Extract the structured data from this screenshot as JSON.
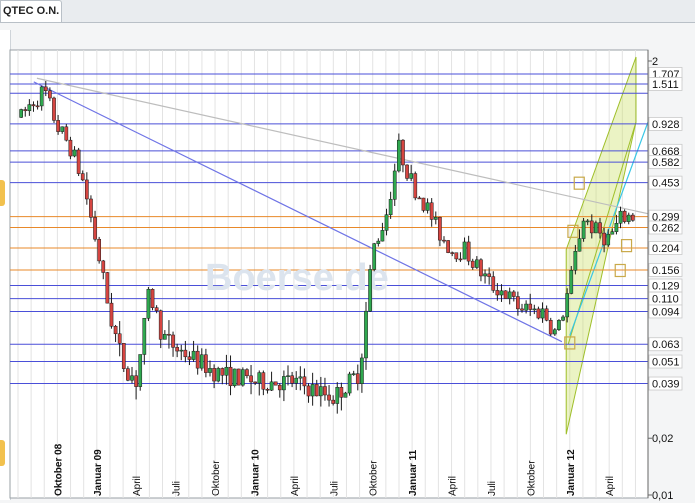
{
  "tab": {
    "title": "QTEC O.N."
  },
  "watermark": "Boerse.de",
  "chart_data": {
    "type": "candlestick",
    "title": "QTEC O.N.",
    "y_scale": "log",
    "ylim": [
      0.01,
      2
    ],
    "y_ticks_gray": [
      "2",
      "0,02",
      "0,01"
    ],
    "y_ticks_boxed": [
      "1.707",
      "1.511",
      "0.928",
      "0.668",
      "0.582",
      "0.453",
      "0.299",
      "0.262",
      "0.204",
      "0.156",
      "0.129",
      "0.110",
      "0.094",
      "0.063",
      "0.051",
      "0.039"
    ],
    "x_labels": [
      {
        "label": "Oktober 08",
        "bold": true
      },
      {
        "label": "Januar 09",
        "bold": true
      },
      {
        "label": "April",
        "bold": false
      },
      {
        "label": "Juli",
        "bold": false
      },
      {
        "label": "Oktober",
        "bold": false
      },
      {
        "label": "Januar 10",
        "bold": true
      },
      {
        "label": "April",
        "bold": false
      },
      {
        "label": "Juli",
        "bold": false
      },
      {
        "label": "Oktober",
        "bold": false
      },
      {
        "label": "Januar 11",
        "bold": true
      },
      {
        "label": "April",
        "bold": false
      },
      {
        "label": "Juli",
        "bold": false
      },
      {
        "label": "Oktober",
        "bold": false
      },
      {
        "label": "Januar 12",
        "bold": true
      },
      {
        "label": "April",
        "bold": false
      }
    ],
    "price_path": [
      [
        "2008-07",
        0.95
      ],
      [
        "2008-08",
        1.2
      ],
      [
        "2008-09",
        1.4
      ],
      [
        "2008-10",
        0.9
      ],
      [
        "2008-11",
        0.7
      ],
      [
        "2008-12",
        0.45
      ],
      [
        "2009-01",
        0.21
      ],
      [
        "2009-02",
        0.09
      ],
      [
        "2009-03",
        0.05
      ],
      [
        "2009-04",
        0.04
      ],
      [
        "2009-05",
        0.12
      ],
      [
        "2009-06",
        0.07
      ],
      [
        "2009-07",
        0.06
      ],
      [
        "2009-08",
        0.055
      ],
      [
        "2009-09",
        0.05
      ],
      [
        "2009-10",
        0.045
      ],
      [
        "2009-11",
        0.043
      ],
      [
        "2009-12",
        0.042
      ],
      [
        "2010-01",
        0.04
      ],
      [
        "2010-04",
        0.04
      ],
      [
        "2010-07",
        0.033
      ],
      [
        "2010-09",
        0.045
      ],
      [
        "2010-10",
        0.2
      ],
      [
        "2010-11",
        0.3
      ],
      [
        "2010-12",
        0.7
      ],
      [
        "2011-01",
        0.45
      ],
      [
        "2011-02",
        0.35
      ],
      [
        "2011-03",
        0.25
      ],
      [
        "2011-04",
        0.2
      ],
      [
        "2011-05",
        0.2
      ],
      [
        "2011-06",
        0.16
      ],
      [
        "2011-07",
        0.13
      ],
      [
        "2011-08",
        0.12
      ],
      [
        "2011-09",
        0.1
      ],
      [
        "2011-10",
        0.095
      ],
      [
        "2011-11",
        0.094
      ],
      [
        "2011-12",
        0.07
      ],
      [
        "2012-01",
        0.13
      ],
      [
        "2012-02",
        0.3
      ],
      [
        "2012-03",
        0.25
      ],
      [
        "2012-04",
        0.23
      ],
      [
        "2012-05",
        0.3
      ]
    ],
    "grid": true,
    "trend_channel": {
      "color": "#c6dd55",
      "direction": "up"
    },
    "legend": "none"
  }
}
